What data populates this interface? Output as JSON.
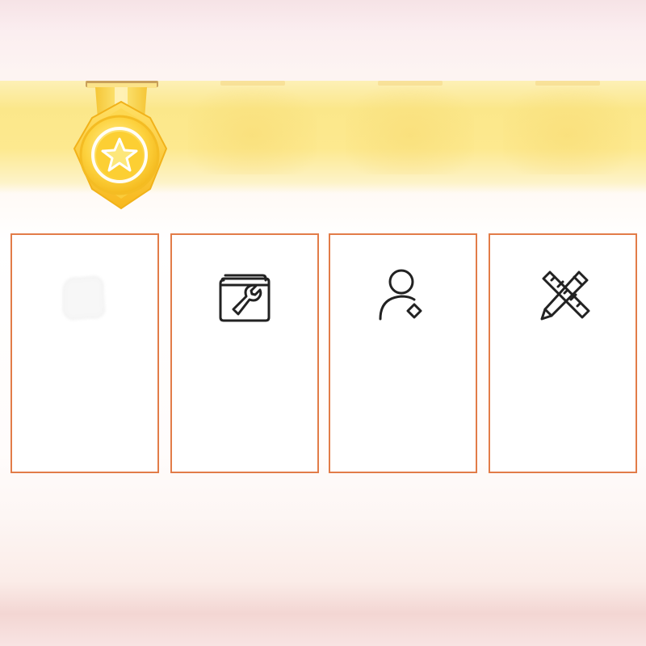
{
  "theme": {
    "banner_color": "#fde98f",
    "medal_gold": "#fbd23c",
    "card_border": "#e27c48",
    "icon_stroke": "#222222"
  },
  "header": {
    "badge_icon": "gold-star-medal",
    "tiles": [
      {
        "icon": "medal-placeholder"
      },
      {
        "icon": "medal-placeholder"
      },
      {
        "icon": "medal-placeholder"
      }
    ]
  },
  "cards": [
    {
      "icon": "faded-placeholder",
      "label": ""
    },
    {
      "icon": "toolbox-wrench",
      "label": ""
    },
    {
      "icon": "user-with-diamond",
      "label": ""
    },
    {
      "icon": "pencil-ruler",
      "label": ""
    }
  ]
}
